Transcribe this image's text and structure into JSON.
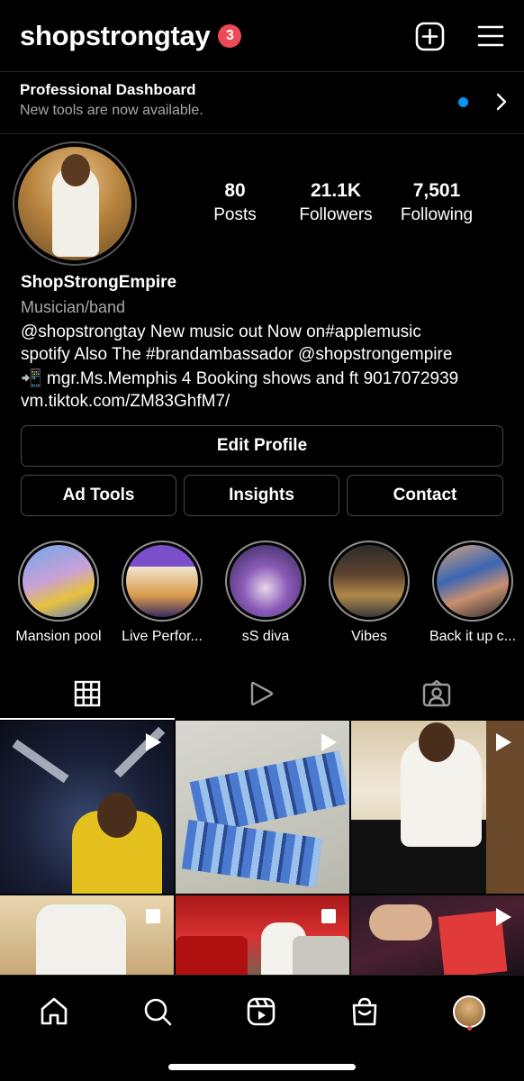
{
  "header": {
    "username": "shopstrongtay",
    "notification_count": "3",
    "create_icon": "plus-square-icon",
    "menu_icon": "hamburger-menu-icon"
  },
  "dashboard": {
    "title": "Professional Dashboard",
    "subtitle": "New tools are now available."
  },
  "stats": [
    {
      "value": "80",
      "label": "Posts"
    },
    {
      "value": "21.1K",
      "label": "Followers"
    },
    {
      "value": "7,501",
      "label": "Following"
    }
  ],
  "bio": {
    "name": "ShopStrongEmpire",
    "category": "Musician/band",
    "lines": [
      "@shopstrongtay New music out Now on#applemusic",
      "spotify Also The #brandambassador @shopstrongempire",
      "📲 mgr.Ms.Memphis 4 Booking shows and ft 9017072939",
      "vm.tiktok.com/ZM83GhfM7/"
    ]
  },
  "buttons": {
    "edit_profile": "Edit Profile",
    "ad_tools": "Ad Tools",
    "insights": "Insights",
    "contact": "Contact"
  },
  "highlights": [
    {
      "label": "Mansion pool"
    },
    {
      "label": "Live Perfor..."
    },
    {
      "label": "sS diva"
    },
    {
      "label": "Vibes"
    },
    {
      "label": "Back it up c..."
    }
  ],
  "tabs": [
    {
      "icon": "grid-icon",
      "active": true
    },
    {
      "icon": "reels-icon",
      "active": false
    },
    {
      "icon": "tagged-icon",
      "active": false
    }
  ],
  "grid_posts": [
    {
      "type": "reel"
    },
    {
      "type": "reel"
    },
    {
      "type": "reel"
    },
    {
      "type": "carousel"
    },
    {
      "type": "carousel"
    },
    {
      "type": "reel"
    }
  ],
  "bottom_nav": [
    {
      "icon": "home-icon"
    },
    {
      "icon": "search-icon"
    },
    {
      "icon": "reels-icon"
    },
    {
      "icon": "shop-icon"
    },
    {
      "icon": "profile-avatar"
    }
  ],
  "colors": {
    "background": "#000000",
    "badge": "#ed4956",
    "accent_blue": "#0095f6",
    "muted_text": "#a8a8a8",
    "border": "#4a4a4a"
  }
}
